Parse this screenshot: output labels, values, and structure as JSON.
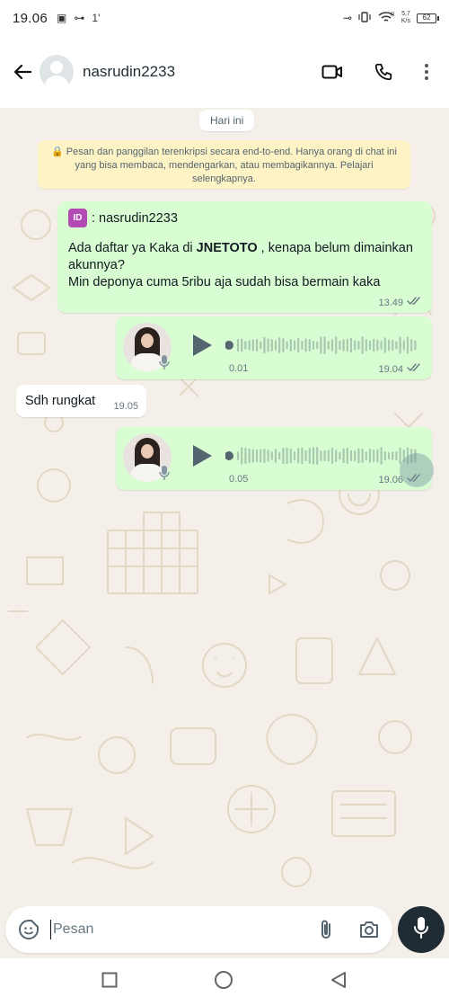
{
  "statusbar": {
    "time": "19.06",
    "left_glyphs": [
      "▣",
      "⊶",
      "1'"
    ],
    "right_glyphs": [
      "⊸",
      "📳",
      "R"
    ],
    "network_speed_top": "5,7",
    "network_speed_bottom": "K/s",
    "battery_level": "62",
    "sim_label": "62"
  },
  "header": {
    "contact_name": "nasrudin2233",
    "icons": [
      "back-arrow-icon",
      "video-call-icon",
      "voice-call-icon",
      "more-vertical-icon"
    ]
  },
  "chat": {
    "date_label": "Hari ini",
    "encryption_notice": "🔒 Pesan dan panggilan terenkripsi secara end-to-end. Hanya orang di chat ini yang bisa membaca, mendengarkan, atau membagikannya. Pelajari selengkapnya.",
    "messages": [
      {
        "direction": "out",
        "badge": "ID",
        "sender_line": ": nasrudin2233",
        "text_before_bold": "Ada daftar ya Kaka di ",
        "bold": "JNETOTO",
        "text_after_bold": " , kenapa belum dimainkan akunnya?",
        "text_line2": "Min deponya cuma 5ribu aja sudah bisa bermain kaka",
        "time": "13.49",
        "status": "read"
      },
      {
        "direction": "out",
        "type": "voice",
        "duration": "0.01",
        "time": "19.04",
        "status": "read"
      },
      {
        "direction": "in",
        "text": "Sdh rungkat",
        "time": "19.05"
      },
      {
        "direction": "out",
        "type": "voice",
        "duration": "0.05",
        "time": "19.06",
        "status": "read"
      }
    ]
  },
  "composer": {
    "placeholder": "Pesan",
    "value": ""
  },
  "colors": {
    "outgoing_bubble": "#d9fdd3",
    "incoming_bubble": "#ffffff",
    "chat_background": "#f4efe8",
    "notice_background": "#fdf3c5",
    "mic_button": "#1f2c34",
    "read_tick": "#667781"
  }
}
